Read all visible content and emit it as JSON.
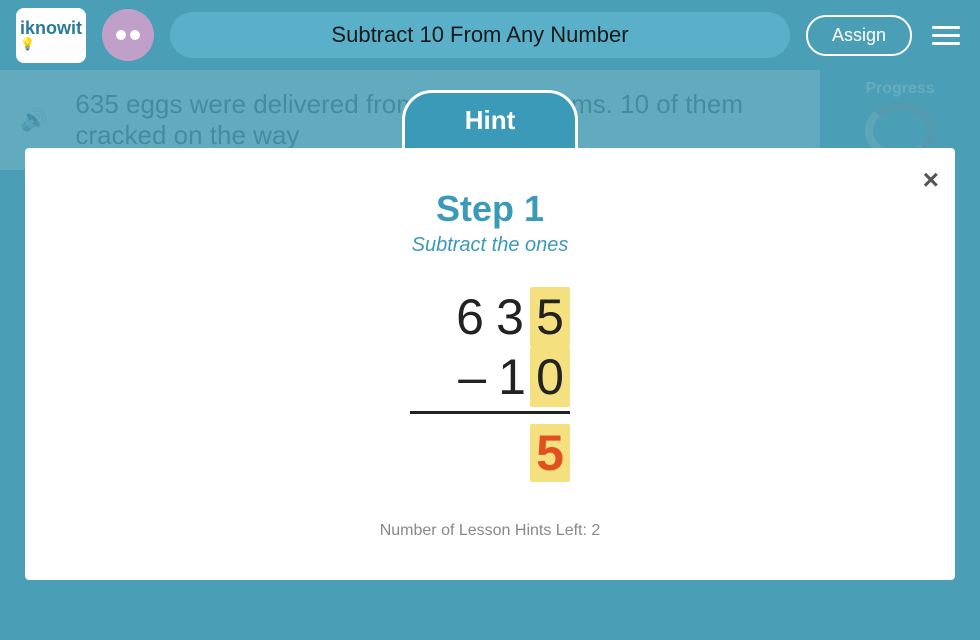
{
  "header": {
    "logo_text": "iknowit",
    "lesson_title": "Subtract 10 From Any Number",
    "assign_label": "Assign",
    "hamburger_aria": "Menu"
  },
  "background": {
    "question_text": "635 eggs were delivered from McIntyre Farms. 10 of them cracked on the way",
    "progress_label": "Progress"
  },
  "hint_modal": {
    "title": "Hint",
    "close_label": "×",
    "step_heading": "Step 1",
    "step_subtitle": "Subtract the ones",
    "math": {
      "top_number": [
        "6",
        "3",
        "5"
      ],
      "top_highlight_index": 2,
      "operator": "–",
      "bottom_number": [
        "1",
        "0"
      ],
      "bottom_highlight_index": 1,
      "bottom_prefix": "",
      "result": "5",
      "result_color": "#e05020"
    },
    "hints_left_label": "Number of Lesson Hints Left: 2"
  }
}
